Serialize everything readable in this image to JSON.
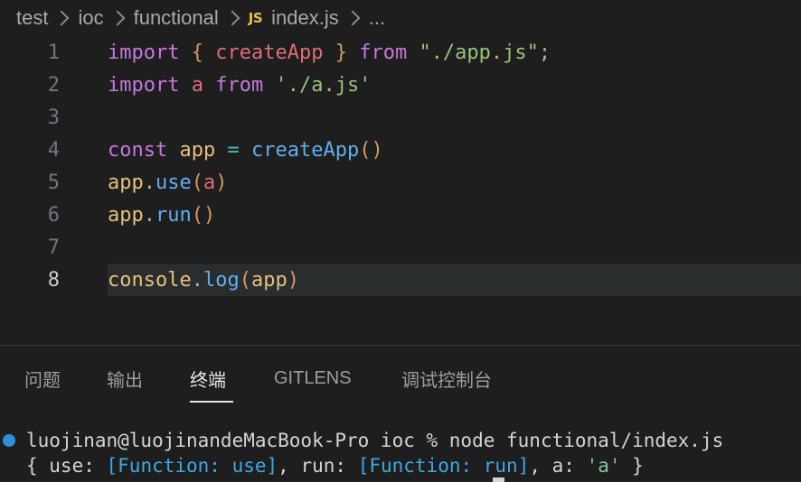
{
  "breadcrumb": {
    "items": [
      "test",
      "ioc",
      "functional"
    ],
    "file_badge": "JS",
    "file": "index.js",
    "more": "..."
  },
  "editor": {
    "active_line": 8,
    "lines": [
      {
        "n": "1"
      },
      {
        "n": "2"
      },
      {
        "n": "3"
      },
      {
        "n": "4"
      },
      {
        "n": "5"
      },
      {
        "n": "6"
      },
      {
        "n": "7"
      },
      {
        "n": "8"
      }
    ],
    "code": {
      "l1": {
        "import": "import",
        "ob": "{",
        "name": "createApp",
        "cb": "}",
        "from": "from",
        "path": "\"./app.js\"",
        "semi": ";"
      },
      "l2": {
        "import": "import",
        "name": "a",
        "from": "from",
        "path": "'./a.js'"
      },
      "l4": {
        "const": "const",
        "var": "app",
        "eq": "=",
        "fn": "createApp",
        "parens": "()"
      },
      "l5": {
        "obj": "app",
        "dot": ".",
        "method": "use",
        "op": "(",
        "arg": "a",
        "cp": ")"
      },
      "l6": {
        "obj": "app",
        "dot": ".",
        "method": "run",
        "parens": "()"
      },
      "l8": {
        "obj": "console",
        "dot": ".",
        "method": "log",
        "op": "(",
        "arg": "app",
        "cp": ")"
      }
    }
  },
  "panel": {
    "tabs": [
      "问题",
      "输出",
      "终端",
      "GITLENS",
      "调试控制台"
    ],
    "active_tab": "终端"
  },
  "terminal": {
    "prompt": "luojinan@luojinandeMacBook-Pro ioc % node functional/index.js",
    "output": {
      "p1": "{ use: ",
      "f1": "[Function: use]",
      "p2": ", run: ",
      "f2": "[Function: run]",
      "p3": ", a: ",
      "s1": "'a'",
      "p4": " }"
    }
  },
  "colors": {
    "background": "#1e1e1e",
    "keyword": "#c678dd",
    "function": "#61afef",
    "variable": "#e5c07b",
    "string": "#98c379",
    "terminal_dot": "#2f8fd8"
  }
}
